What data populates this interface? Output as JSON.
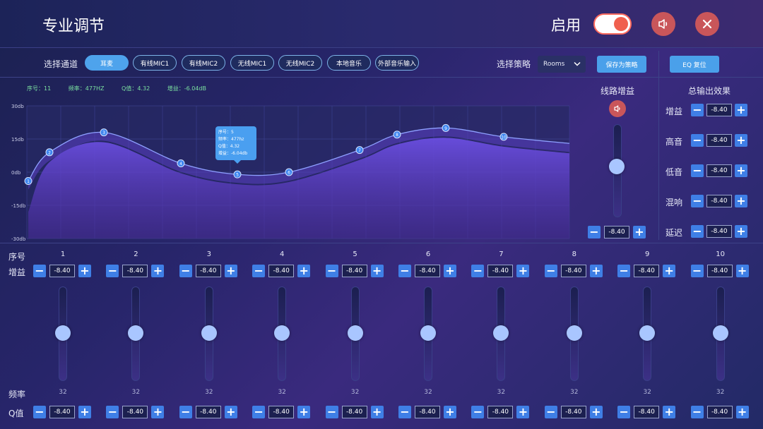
{
  "header": {
    "title": "专业调节",
    "enable_label": "启用"
  },
  "toolbar": {
    "channel_label": "选择通道",
    "channels": [
      "耳麦",
      "有线MIC1",
      "有线MIC2",
      "无线MIC1",
      "无线MIC2",
      "本地音乐",
      "外部音乐输入"
    ],
    "strategy_label": "选择策略",
    "strategy_value": "Rooms",
    "save_label": "保存为策略",
    "reset_label": "EQ 复位"
  },
  "info": {
    "seq": "序号：11",
    "freq": "频率：477HZ",
    "q": "Q值：4.32",
    "gain": "增益：-6.04dB"
  },
  "tooltip": {
    "lines": [
      "序号：5",
      "频率：477hz",
      "Q值：4.32",
      "增益：-6.04db"
    ]
  },
  "chart_data": {
    "type": "line",
    "ylim": [
      -30,
      30
    ],
    "yticks": [
      "30db",
      "15db",
      "0db",
      "-15db",
      "-30db"
    ],
    "points": [
      {
        "label": "1",
        "value": -4
      },
      {
        "label": "2",
        "value": 9
      },
      {
        "label": "3",
        "value": 18
      },
      {
        "label": "4",
        "value": 4
      },
      {
        "label": "5",
        "value": -1
      },
      {
        "label": "6",
        "value": 0
      },
      {
        "label": "7",
        "value": 10
      },
      {
        "label": "8",
        "value": 17
      },
      {
        "label": "9",
        "value": 20
      },
      {
        "label": "10",
        "value": 16
      }
    ]
  },
  "line_gain": {
    "title": "线路增益",
    "value": "-8.40",
    "level": 0.62
  },
  "output": {
    "title": "总输出效果",
    "rows": [
      {
        "label": "增益",
        "value": "-8.40"
      },
      {
        "label": "高音",
        "value": "-8.40"
      },
      {
        "label": "低音",
        "value": "-8.40"
      },
      {
        "label": "混响",
        "value": "-8.40"
      },
      {
        "label": "延迟",
        "value": "-8.40"
      }
    ]
  },
  "bands": {
    "seq_label": "序号",
    "gain_label": "增益",
    "freq_label": "频率",
    "q_label": "Q值",
    "items": [
      {
        "num": "1",
        "gain": "-8.40",
        "freq": "32",
        "q": "-8.40",
        "level": 0.6
      },
      {
        "num": "2",
        "gain": "-8.40",
        "freq": "32",
        "q": "-8.40",
        "level": 0.6
      },
      {
        "num": "3",
        "gain": "-8.40",
        "freq": "32",
        "q": "-8.40",
        "level": 0.6
      },
      {
        "num": "4",
        "gain": "-8.40",
        "freq": "32",
        "q": "-8.40",
        "level": 0.6
      },
      {
        "num": "5",
        "gain": "-8.40",
        "freq": "32",
        "q": "-8.40",
        "level": 0.6
      },
      {
        "num": "6",
        "gain": "-8.40",
        "freq": "32",
        "q": "-8.40",
        "level": 0.6
      },
      {
        "num": "7",
        "gain": "-8.40",
        "freq": "32",
        "q": "-8.40",
        "level": 0.6
      },
      {
        "num": "8",
        "gain": "-8.40",
        "freq": "32",
        "q": "-8.40",
        "level": 0.6
      },
      {
        "num": "9",
        "gain": "-8.40",
        "freq": "32",
        "q": "-8.40",
        "level": 0.6
      },
      {
        "num": "10",
        "gain": "-8.40",
        "freq": "32",
        "q": "-8.40",
        "level": 0.6
      }
    ]
  }
}
